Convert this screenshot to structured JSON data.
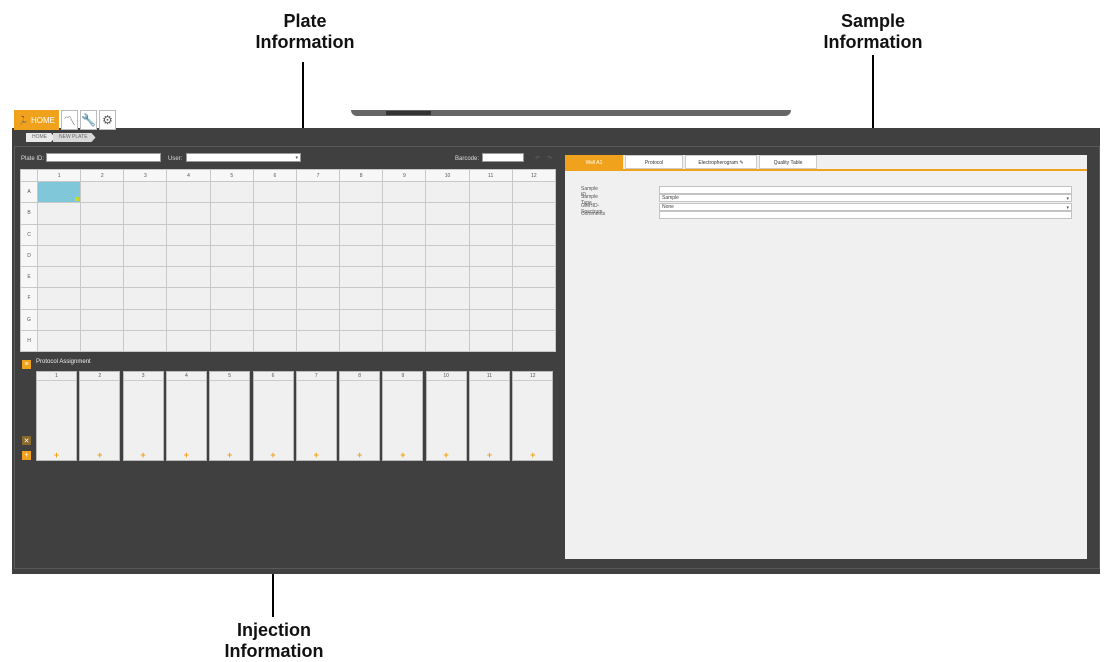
{
  "annotations": {
    "plate_info": [
      "Plate",
      "Information"
    ],
    "sample_info": [
      "Sample",
      "Information"
    ],
    "injection_info": [
      "Injection",
      "Information"
    ]
  },
  "nav": {
    "home_label": "HOME",
    "icons": [
      "run-icon",
      "electropherogram-icon",
      "wrench-icon",
      "gear-icon"
    ]
  },
  "breadcrumb": [
    "HOME",
    "NEW PLATE"
  ],
  "plate_header": {
    "plate_id_label": "Plate ID:",
    "plate_id_value": "",
    "user_label": "User:",
    "user_value": "",
    "barcode_label": "Barcode:",
    "barcode_value": ""
  },
  "plate": {
    "columns": [
      "1",
      "2",
      "3",
      "4",
      "5",
      "6",
      "7",
      "8",
      "9",
      "10",
      "11",
      "12"
    ],
    "rows": [
      "A",
      "B",
      "C",
      "D",
      "E",
      "F",
      "G",
      "H"
    ],
    "selected_well": "A1"
  },
  "protocol_assignment": {
    "title": "Protocol Assignment",
    "columns": [
      "1",
      "2",
      "3",
      "4",
      "5",
      "6",
      "7",
      "8",
      "9",
      "10",
      "11",
      "12"
    ],
    "add_symbol": "+"
  },
  "sample_panel": {
    "tabs": [
      "Well A1",
      "Protocol",
      "Electropherogram",
      "Quality Table"
    ],
    "active_tab": "Well A1",
    "fields": [
      {
        "label": "Sample ID",
        "value": ""
      },
      {
        "label": "Sample Type",
        "value": "Sample"
      },
      {
        "label": "GMHID-Spectrum",
        "value": "None"
      },
      {
        "label": "Comments",
        "value": ""
      }
    ]
  },
  "colors": {
    "accent": "#f0a21c",
    "app_background": "#404040",
    "panel_background": "#f0f0f0",
    "selected_well": "#7fc7d9"
  }
}
